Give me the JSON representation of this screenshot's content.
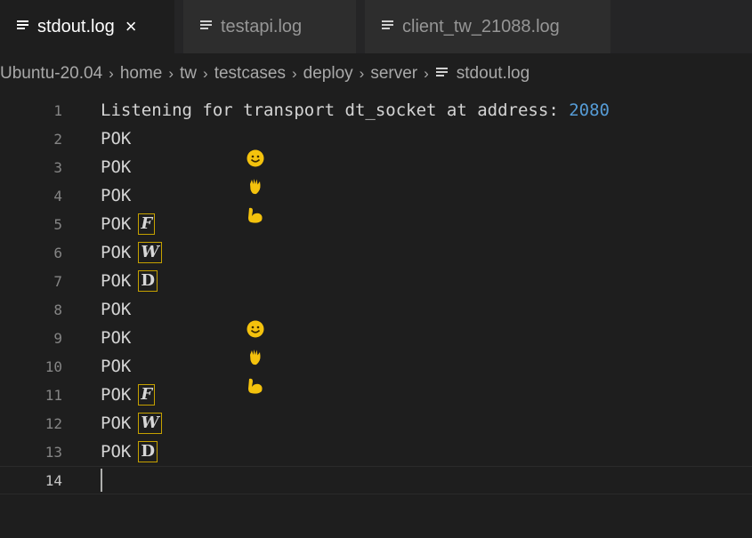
{
  "tabs": [
    {
      "label": "stdout.log",
      "active": true,
      "close": "×"
    },
    {
      "label": "testapi.log",
      "active": false
    },
    {
      "label": "client_tw_21088.log",
      "active": false
    }
  ],
  "breadcrumb": {
    "items": [
      "Ubuntu-20.04",
      "home",
      "tw",
      "testcases",
      "deploy",
      "server"
    ],
    "file": "stdout.log",
    "separator": "›"
  },
  "editor": {
    "lines": [
      {
        "number": "1",
        "text": "Listening for transport dt_socket at address: ",
        "value": "2080"
      },
      {
        "number": "2",
        "text": "POK",
        "icon": "smiley-emoji-icon"
      },
      {
        "number": "3",
        "text": "POK",
        "icon": "waving-hand-emoji-icon"
      },
      {
        "number": "4",
        "text": "POK",
        "icon": "flexed-biceps-emoji-icon"
      },
      {
        "number": "5",
        "text": "POK",
        "letter": "F"
      },
      {
        "number": "6",
        "text": "POK",
        "letter": "W"
      },
      {
        "number": "7",
        "text": "POK",
        "letter": "D"
      },
      {
        "number": "8",
        "text": "POK",
        "icon": "smiley-emoji-icon"
      },
      {
        "number": "9",
        "text": "POK",
        "icon": "waving-hand-emoji-icon"
      },
      {
        "number": "10",
        "text": "POK",
        "icon": "flexed-biceps-emoji-icon"
      },
      {
        "number": "11",
        "text": "POK",
        "letter": "F"
      },
      {
        "number": "12",
        "text": "POK",
        "letter": "W"
      },
      {
        "number": "13",
        "text": "POK",
        "letter": "D"
      },
      {
        "number": "14",
        "text": ""
      }
    ],
    "current_line": "14"
  },
  "colors": {
    "background": "#1e1e1e",
    "tab_inactive": "#2d2d2d",
    "number_literal": "#569cd6",
    "emoji_yellow": "#f4c20d",
    "letter_border": "#c5a100"
  }
}
